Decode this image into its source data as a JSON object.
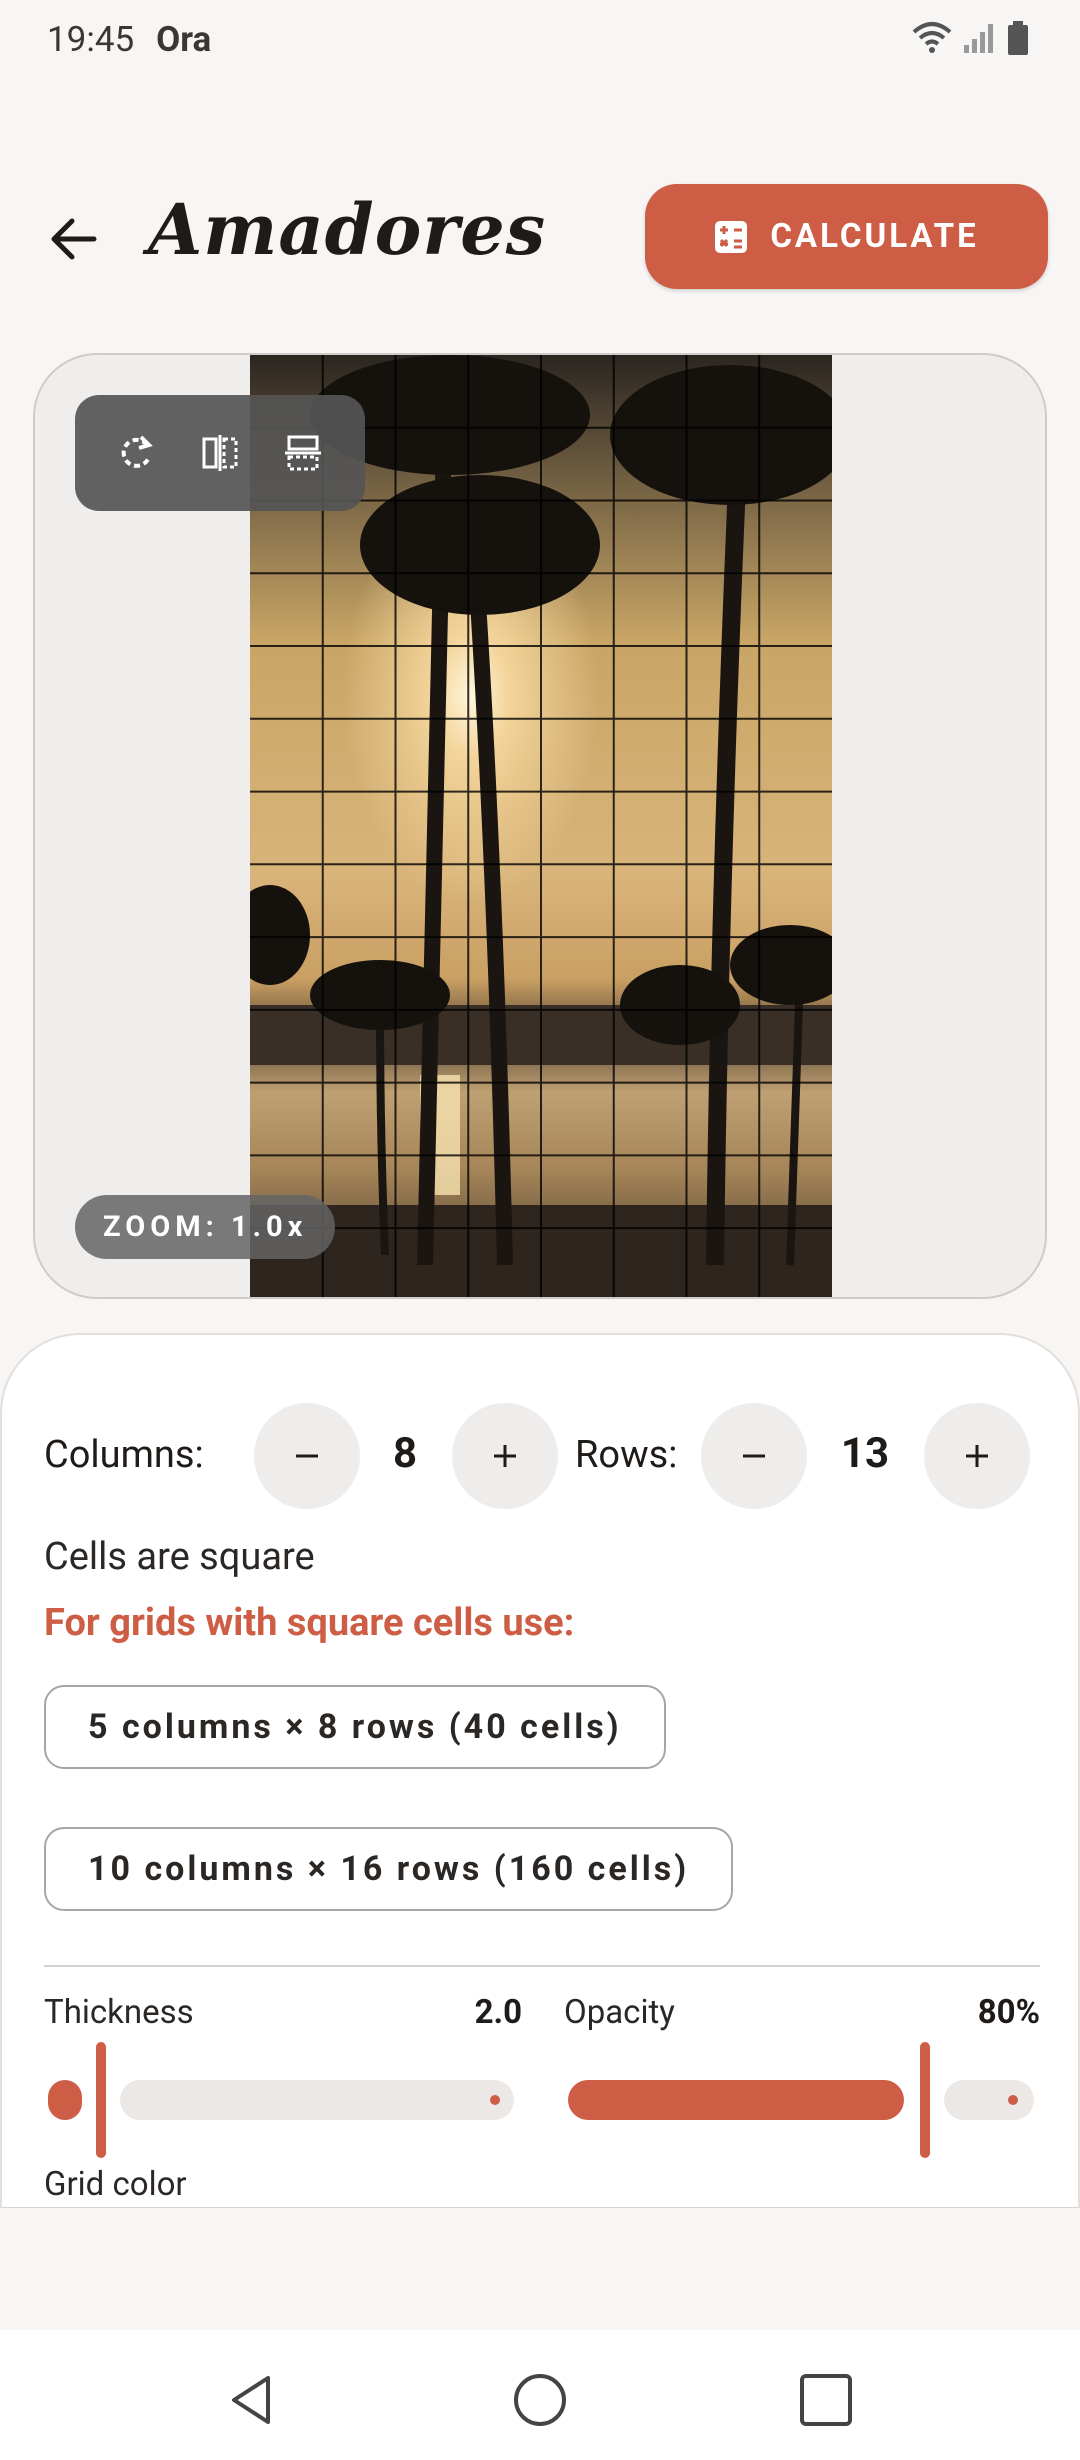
{
  "status": {
    "time": "19:45",
    "carrier": "Ora"
  },
  "header": {
    "title": "Amadores",
    "calculate_label": "CALCULATE"
  },
  "preview": {
    "zoom_label": "ZOOM: 1.0x",
    "grid": {
      "columns": 8,
      "rows": 13
    }
  },
  "controls": {
    "columns_label": "Columns:",
    "columns_value": "8",
    "rows_label": "Rows:",
    "rows_value": "13",
    "minus": "−",
    "plus": "+",
    "cells_text": "Cells are square",
    "hint_text": "For grids with square cells use:",
    "suggestions": [
      "5 columns × 8 rows (40 cells)",
      "10 columns × 16 rows (160 cells)"
    ],
    "thickness_label": "Thickness",
    "thickness_value": "2.0",
    "thickness_level": 0.1,
    "opacity_label": "Opacity",
    "opacity_value": "80%",
    "opacity_level": 0.8,
    "grid_color_label": "Grid color"
  },
  "colors": {
    "accent": "#cd5e45",
    "background": "#f8f6f4"
  },
  "icons": [
    "back-arrow-icon",
    "calculator-icon",
    "rotate-icon",
    "flip-horizontal-icon",
    "flip-vertical-icon",
    "wifi-icon",
    "signal-icon",
    "battery-icon",
    "nav-back-icon",
    "nav-home-icon",
    "nav-recents-icon"
  ]
}
